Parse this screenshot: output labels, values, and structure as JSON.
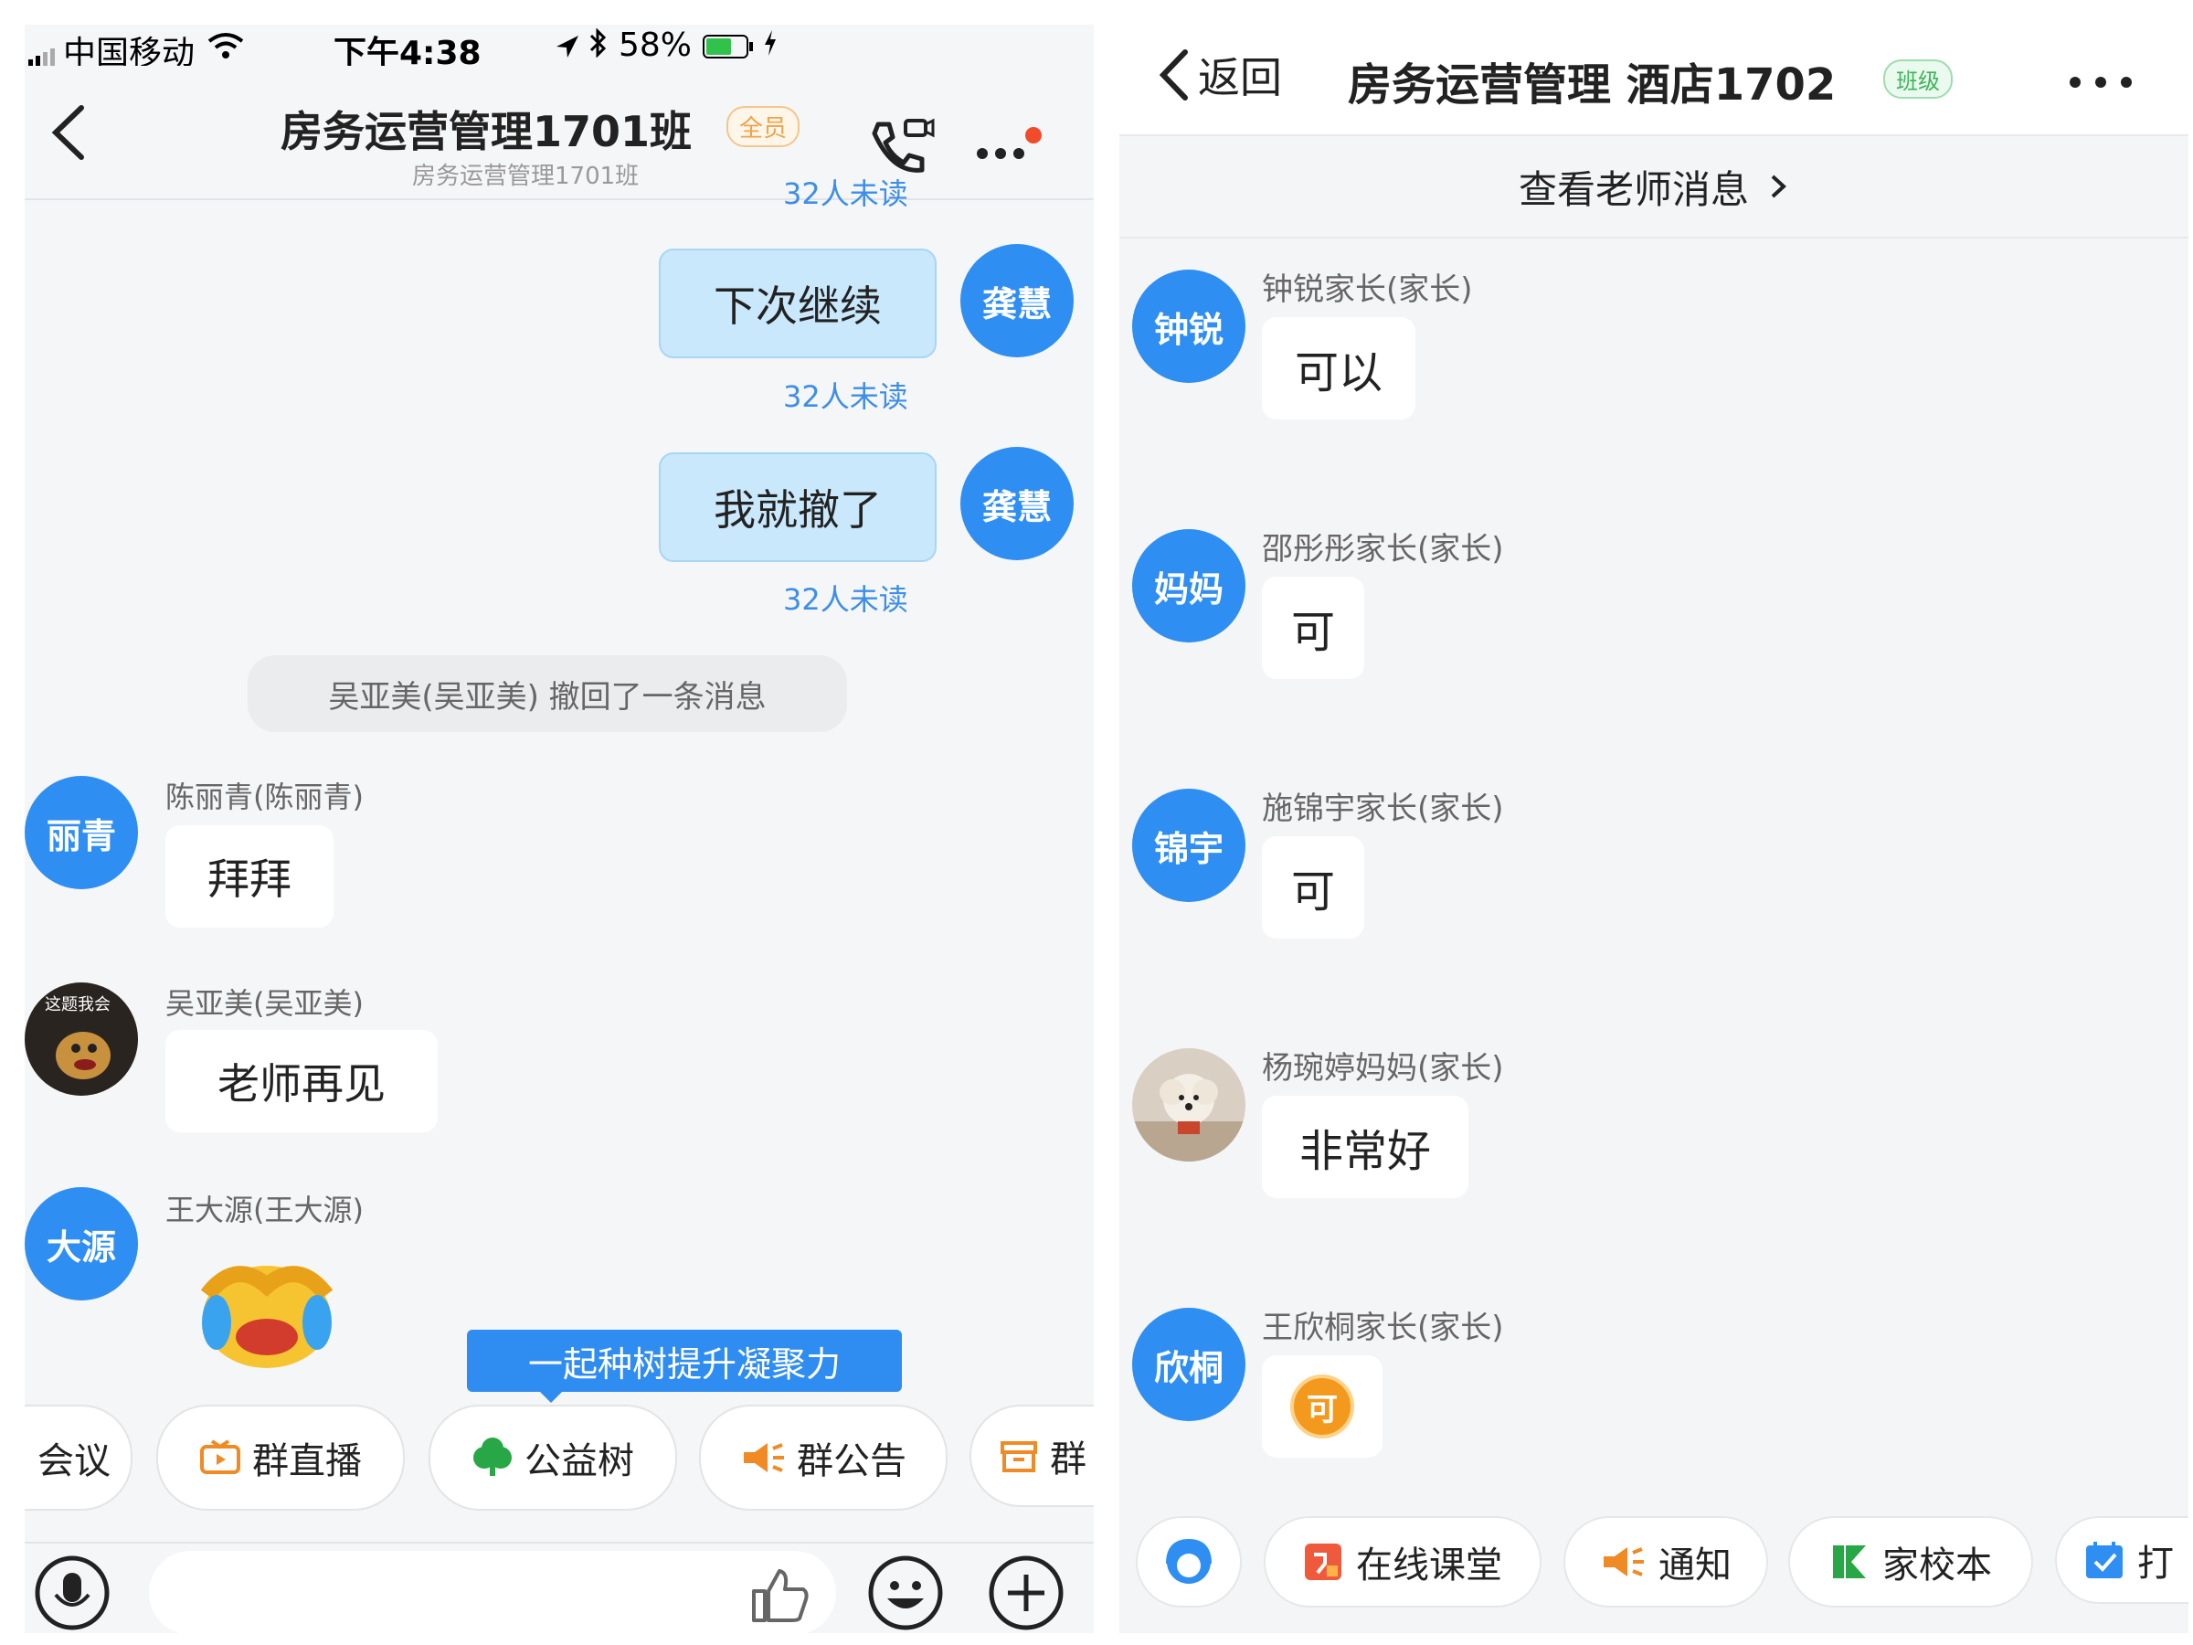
{
  "left": {
    "status": {
      "carrier": "中国移动",
      "time": "下午4:38",
      "battery": "58%"
    },
    "header": {
      "title": "房务运营管理1701班",
      "tag": "全员",
      "subtitle": "房务运营管理1701班"
    },
    "messages_me": [
      {
        "text": "下次继续",
        "avatar": "龚慧",
        "unread": "32人未读"
      },
      {
        "text": "我就撤了",
        "avatar": "龚慧",
        "unread": "32人未读"
      }
    ],
    "top_unread": "32人未读",
    "recall_notice": "吴亚美(吴亚美) 撤回了一条消息",
    "messages_others": [
      {
        "sender": "陈丽青(陈丽青)",
        "avatar": "丽青",
        "text": "拜拜"
      },
      {
        "sender": "吴亚美(吴亚美)",
        "avatar_caption": "这题我会",
        "text": "老师再见"
      },
      {
        "sender": "王大源(王大源)",
        "avatar": "大源"
      }
    ],
    "tooltip": "一起种树提升凝聚力",
    "tools": [
      "会议",
      "群直播",
      "公益树",
      "群公告",
      "群"
    ],
    "colors": {
      "accent": "#2e8ef2",
      "orange": "#f08a24",
      "green": "#27a745"
    }
  },
  "right": {
    "nav": {
      "back": "返回",
      "title": "房务运营管理 酒店1702",
      "tag": "班级"
    },
    "teacher_link": "查看老师消息",
    "messages": [
      {
        "sender": "钟锐家长(家长)",
        "avatar": "钟锐",
        "text": "可以"
      },
      {
        "sender": "邵彤彤家长(家长)",
        "avatar": "妈妈",
        "text": "可"
      },
      {
        "sender": "施锦宇家长(家长)",
        "avatar": "锦宇",
        "text": "可"
      },
      {
        "sender": "杨琬婷妈妈(家长)",
        "text": "非常好"
      },
      {
        "sender": "王欣桐家长(家长)",
        "avatar": "欣桐",
        "sticker": "可"
      }
    ],
    "tools": [
      "在线课堂",
      "通知",
      "家校本",
      "打"
    ]
  }
}
